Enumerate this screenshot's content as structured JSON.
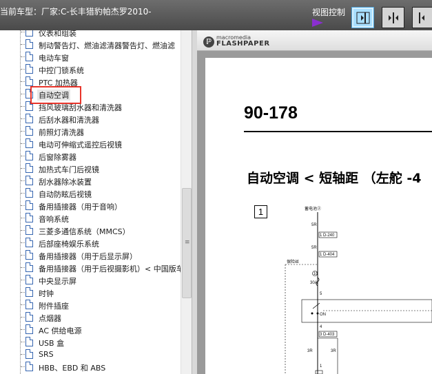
{
  "header": {
    "title": "当前车型：厂家:C-长丰猎豹帕杰罗2010-",
    "view_control_label": "视图控制"
  },
  "tree": {
    "items": [
      {
        "label": "仪表和组装"
      },
      {
        "label": "制动警告灯、燃油滤清器警告灯、燃油滤"
      },
      {
        "label": "电动车窗"
      },
      {
        "label": "中控门锁系统"
      },
      {
        "label": "PTC 加热器"
      },
      {
        "label": "自动空调",
        "selected": true
      },
      {
        "label": "挡风玻璃刮水器和清洗器"
      },
      {
        "label": "后刮水器和清洗器"
      },
      {
        "label": "前照灯清洗器"
      },
      {
        "label": "电动可伸缩式遥控后视镜"
      },
      {
        "label": "后窗除雾器"
      },
      {
        "label": "加热式车门后视镜"
      },
      {
        "label": "刮水器除冰装置"
      },
      {
        "label": "自动防眩后视镜"
      },
      {
        "label": "备用插接器（用于音响）"
      },
      {
        "label": "音响系统"
      },
      {
        "label": "三菱多通信系统（MMCS）"
      },
      {
        "label": "后部座椅娱乐系统"
      },
      {
        "label": "备用插接器（用于后显示屏）"
      },
      {
        "label": "备用插接器（用于后视摄影机）< 中国版车"
      },
      {
        "label": "中央显示屏"
      },
      {
        "label": "时钟"
      },
      {
        "label": "附件插座"
      },
      {
        "label": "点烟器"
      },
      {
        "label": "AC 供给电源"
      },
      {
        "label": "USB 盒"
      },
      {
        "label": "SRS"
      },
      {
        "label": "HBB、EBD 和 ABS"
      }
    ]
  },
  "viewer": {
    "brand_top": "macromedia",
    "brand_bottom": "FLASHPAPER",
    "page_number": "90-178",
    "section_title": "自动空调 < 短轴距 （左舵 -4",
    "diagram_index": "1",
    "schematic_labels": {
      "top_label": "蓄电池②",
      "wire_5r_top": "5R",
      "connector_1": "1 D-240",
      "wire_5r_mid": "5R",
      "connector_2": "1 D-404",
      "left_box_label": "保险丝",
      "fuse_num": "10",
      "fuse_amp": "30A",
      "pin_5": "5",
      "pin_4": "4",
      "on_label": "ON",
      "connector_3": "3 D-403",
      "wire_3r_left": "3R",
      "wire_3r_right": "3R",
      "pin_1": "1"
    }
  },
  "colors": {
    "header_bg": "#5a5a5a",
    "highlight_border": "#e8342a",
    "selected_button_bg": "#a9dfff",
    "triangle": "#8a2fd0"
  }
}
